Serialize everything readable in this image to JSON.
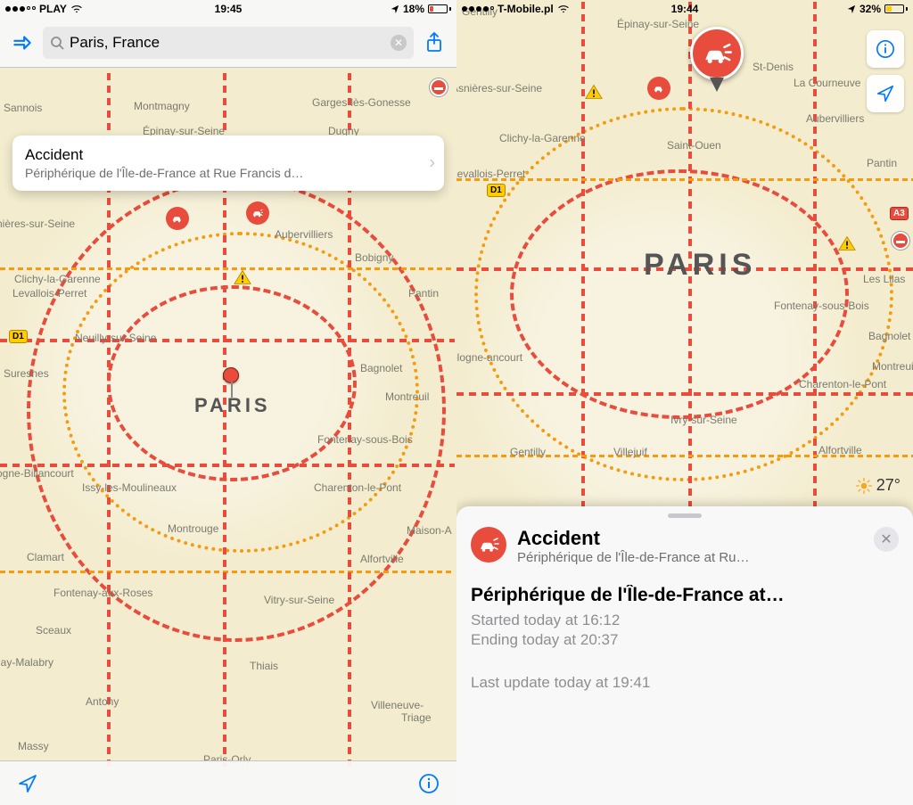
{
  "left": {
    "status": {
      "carrier": "PLAY",
      "time": "19:45",
      "battery_pct": "18%",
      "signal_filled": 3
    },
    "search": {
      "query": "Paris, France"
    },
    "callout": {
      "title": "Accident",
      "subtitle": "Périphérique de l'Île-de-France at Rue Francis d…"
    },
    "highways": {
      "d1": "D1"
    },
    "city_label": "Paris",
    "places": {
      "sannois": "Sannois",
      "montmagny": "Montmagny",
      "garges": "Garges-lès-Gonesse",
      "epinay": "Épinay-sur-Seine",
      "dugny": "Dugny",
      "aubervilliers": "Aubervilliers",
      "asnieres": "nières-sur-Seine",
      "bobigny": "Bobigny",
      "clichy": "Clichy-la-Garenne",
      "levallois": "Levallois-Perret",
      "neuilly": "Neuilly-sur-Seine",
      "suresnes": "Suresnes",
      "bagnolet": "Bagnolet",
      "montreuil": "Montreuil",
      "fontenay": "Fontenay-sous-Bois",
      "boulogne": "ogne-Billancourt",
      "issy": "Issy-les-Moulineaux",
      "charenton": "Charenton-le-Pont",
      "montrouge": "Montrouge",
      "clamart": "Clamart",
      "maison": "Maison-A",
      "alfortville": "Alfortville",
      "fontrose": "Fontenay-aux-Roses",
      "vitry": "Vitry-sur-Seine",
      "sceaux": "Sceaux",
      "malabry": "nay-Malabry",
      "thiais": "Thiais",
      "antony": "Antony",
      "villeneuve": "Villeneuve-",
      "triage": "Triage",
      "massy": "Massy",
      "orly": "Paris-Orly",
      "pantin": "Pantin"
    }
  },
  "right": {
    "status": {
      "carrier": "T-Mobile.pl",
      "time": "19:44",
      "battery_pct": "32%",
      "signal_filled": 4
    },
    "highways": {
      "d1": "D1",
      "a3": "A3"
    },
    "city_label": "Paris",
    "weather": {
      "temp": "27°"
    },
    "sheet": {
      "title": "Accident",
      "subtitle": "Périphérique de l'Île-de-France at Ru…",
      "location": "Périphérique de l'Île-de-France at…",
      "started": "Started today at 16:12",
      "ending": "Ending today at 20:37",
      "updated": "Last update today at 19:41"
    },
    "places": {
      "gentilly": "Gentilly",
      "epinay": "Épinay-sur-Seine",
      "stdenis": "St-Denis",
      "courneuve": "La Courneuve",
      "aubervilliers": "Aubervilliers",
      "asnieres": "Asnières-sur-Seine",
      "clichy": "Clichy-la-Garenne",
      "levallois": "Levallois-Perret",
      "stouen": "Saint-Ouen",
      "pantin": "Pantin",
      "fontenay": "Fontenay-sous-Bois",
      "bagnolet": "Bagnolet",
      "montreuil": "Montreuil",
      "ivry": "Ivry-sur-Seine",
      "charenton": "Charenton-le-Pont",
      "villejuif": "Villejuif",
      "gentilly2": "Gentilly",
      "alfortville": "Alfortville",
      "leslilas": "Les Lilas",
      "boulogne": "ologne-ancourt"
    }
  }
}
